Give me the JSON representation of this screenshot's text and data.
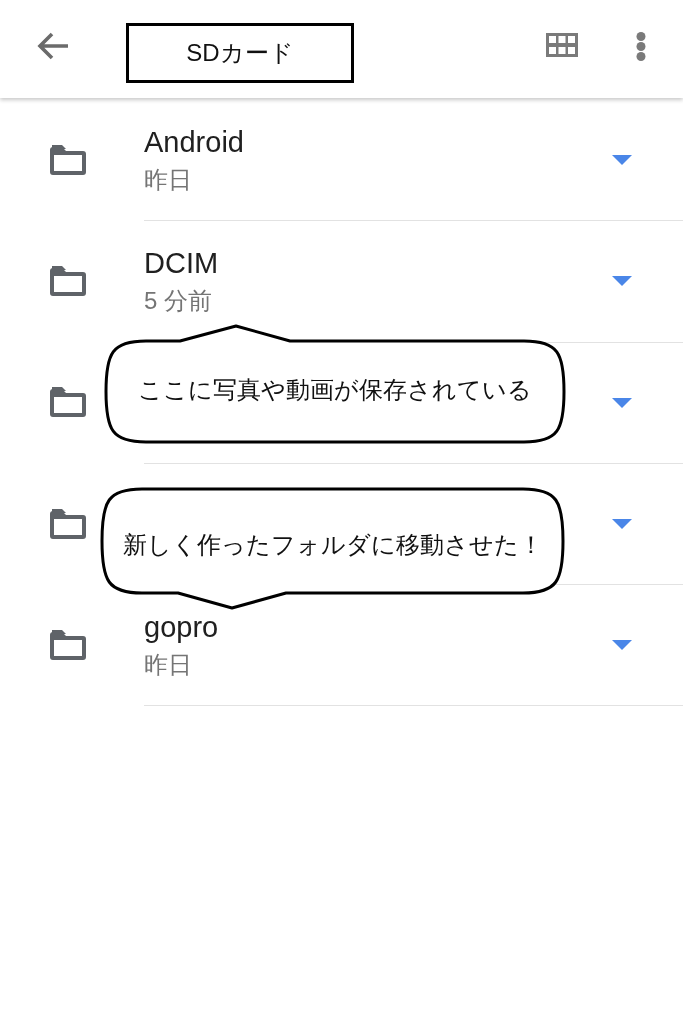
{
  "toolbar": {
    "title": "SDカード"
  },
  "folders": [
    {
      "kind": "folder",
      "name": "Android",
      "modified": "昨日"
    },
    {
      "kind": "folder",
      "name": "DCIM",
      "modified": "5 分前"
    },
    {
      "kind": "folder"
    },
    {
      "kind": "folder"
    },
    {
      "kind": "folder",
      "name": "gopro",
      "modified": "昨日"
    }
  ],
  "callouts": [
    {
      "kind": "up",
      "text": "ここに写真や動画が保存されている"
    },
    {
      "kind": "down",
      "text": "新しく作ったフォルダに移動させた！"
    }
  ]
}
